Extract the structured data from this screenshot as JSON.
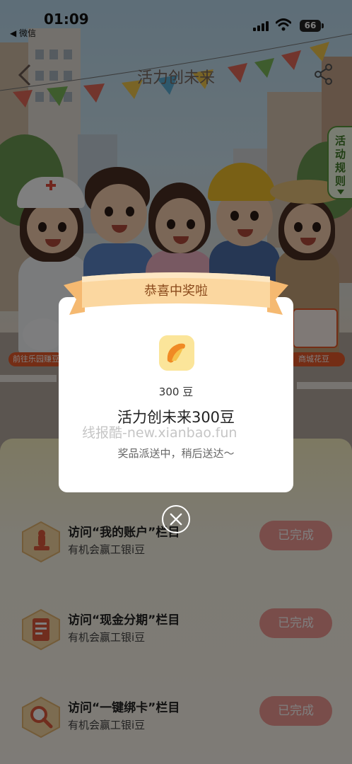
{
  "status_bar": {
    "time": "01:09",
    "back_app": "◀ 微信",
    "battery": "66"
  },
  "nav": {
    "title": "活力创未来"
  },
  "rules_tab": {
    "label": "活动规则"
  },
  "side_buttons": {
    "left": "前往乐园赚豆",
    "right": "商城花豆"
  },
  "tasks": [
    {
      "title": "访问“我的账户”栏目",
      "subtitle": "有机会赢工银i豆",
      "button": "已完成",
      "icon": "stamp-icon"
    },
    {
      "title": "访问“现金分期”栏目",
      "subtitle": "有机会赢工银i豆",
      "button": "已完成",
      "icon": "checklist-icon"
    },
    {
      "title": "访问“一键绑卡”栏目",
      "subtitle": "有机会赢工银i豆",
      "button": "已完成",
      "icon": "magnifier-icon"
    }
  ],
  "modal": {
    "header": "恭喜中奖啦",
    "amount": "300 豆",
    "prize_name": "活力创未来300豆",
    "note": "奖品派送中，稍后送达～",
    "icon": "bean-icon"
  },
  "watermark": "线报酷-new.xianbao.fun",
  "colors": {
    "accent_orange": "#e95a2b",
    "done_button": "#f29b94",
    "ribbon": "#f9c98a",
    "rules_green": "#5d9a3c"
  }
}
